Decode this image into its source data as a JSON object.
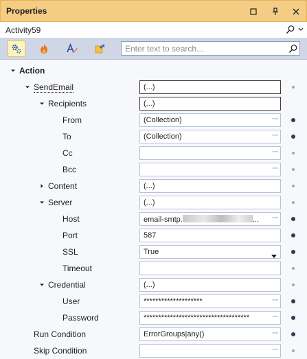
{
  "panel": {
    "title": "Properties"
  },
  "titlebar_icons": [
    "maximize-icon",
    "pin-icon",
    "close-icon"
  ],
  "object_selector": {
    "value": "Activity59"
  },
  "toolbar": {
    "buttons": [
      "properties-gear-icon",
      "events-fire-icon",
      "font-a-icon",
      "pin-note-icon"
    ],
    "search_placeholder": "Enter text to search..."
  },
  "colors": {
    "title_bg": "#f5cc84",
    "panel_bg": "#cfd6e5",
    "grid_bg": "#f7f8fb",
    "active_button": "#fdf4bf"
  },
  "rows": [
    {
      "label": "Action",
      "bold": true,
      "expander": "expanded",
      "value": null,
      "marker": "none"
    },
    {
      "label": "SendEmail",
      "expander": "expanded",
      "value": "(...)",
      "editor": "selected",
      "marker": "small"
    },
    {
      "label": "Recipients",
      "expander": "expanded",
      "value": "(...)",
      "editor": "selected",
      "marker": "none"
    },
    {
      "label": "From",
      "value": "(Collection)",
      "editor": "ellipsis",
      "marker": "big"
    },
    {
      "label": "To",
      "value": "(Collection)",
      "editor": "ellipsis",
      "marker": "big"
    },
    {
      "label": "Cc",
      "value": "",
      "editor": "ellipsis",
      "marker": "small"
    },
    {
      "label": "Bcc",
      "value": "",
      "editor": "ellipsis",
      "marker": "small"
    },
    {
      "label": "Content",
      "expander": "collapsed",
      "value": "(...)",
      "marker": "small"
    },
    {
      "label": "Server",
      "expander": "expanded",
      "value": "(...)",
      "marker": "small"
    },
    {
      "label": "Host",
      "value": "email-smtp.",
      "redacted": true,
      "value_suffix": "...",
      "editor": "ellipsis",
      "marker": "big"
    },
    {
      "label": "Port",
      "value": "587",
      "marker": "big"
    },
    {
      "label": "SSL",
      "value": "True",
      "editor": "dropdown",
      "marker": "big"
    },
    {
      "label": "Timeout",
      "value": "",
      "marker": "small"
    },
    {
      "label": "Credential",
      "expander": "expanded",
      "value": "(...)",
      "marker": "small"
    },
    {
      "label": "User",
      "value": "********************",
      "editor": "ellipsis",
      "marker": "big"
    },
    {
      "label": "Password",
      "value": "************************************",
      "editor": "ellipsis",
      "marker": "big"
    },
    {
      "label": "Run Condition",
      "value": "ErrorGroups|any()",
      "editor": "ellipsis",
      "marker": "big"
    },
    {
      "label": "Skip Condition",
      "value": "",
      "editor": "ellipsis",
      "marker": "small"
    }
  ]
}
